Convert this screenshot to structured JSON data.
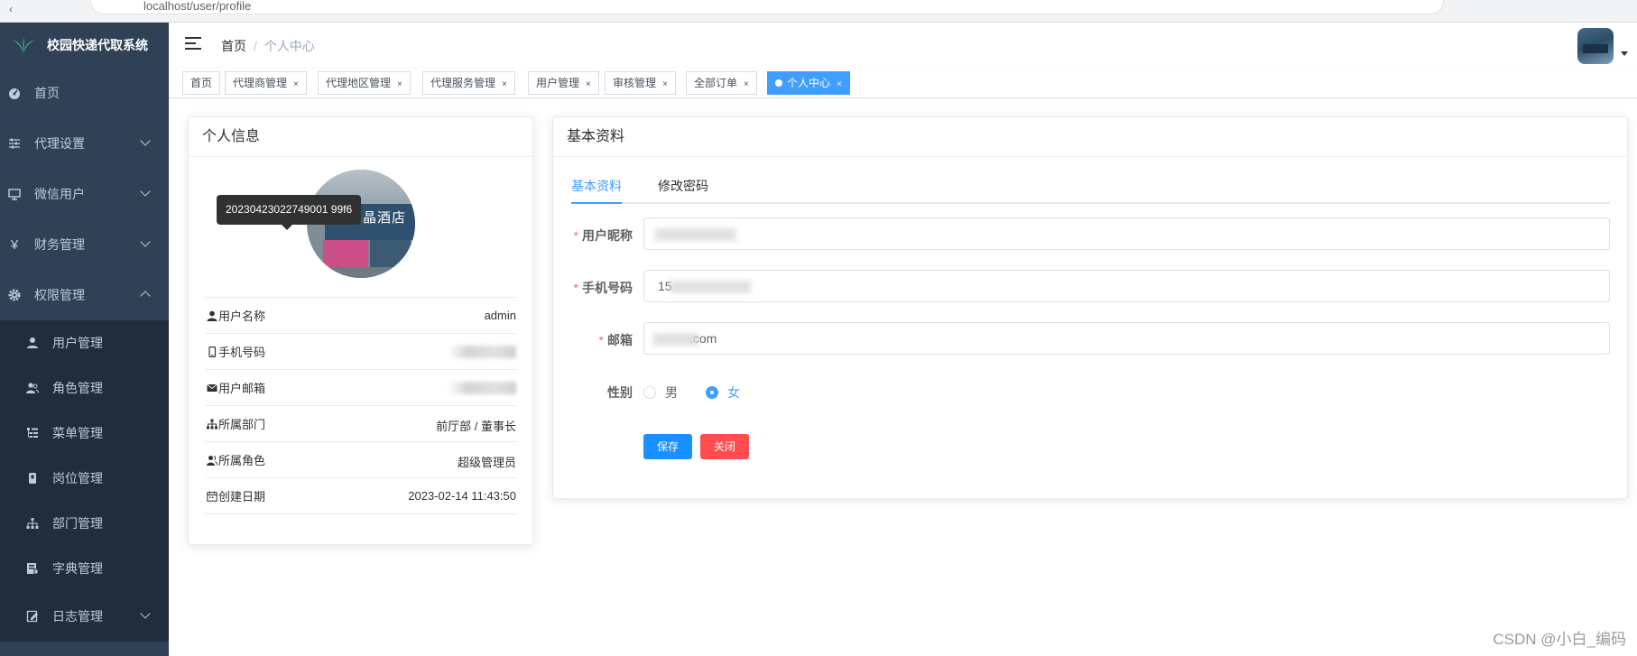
{
  "browser": {
    "url": "localhost/user/profile"
  },
  "app": {
    "title": "校园快递代取系统"
  },
  "sidebar": {
    "items": [
      {
        "label": "首页",
        "icon": "dashboard-icon"
      },
      {
        "label": "代理设置",
        "icon": "sliders-icon"
      },
      {
        "label": "微信用户",
        "icon": "monitor-icon"
      },
      {
        "label": "财务管理",
        "icon": "yen-icon"
      },
      {
        "label": "权限管理",
        "icon": "gear-icon"
      }
    ],
    "submenu": [
      {
        "label": "用户管理",
        "icon": "user-icon"
      },
      {
        "label": "角色管理",
        "icon": "peoples-icon"
      },
      {
        "label": "菜单管理",
        "icon": "tree-table-icon"
      },
      {
        "label": "岗位管理",
        "icon": "post-icon"
      },
      {
        "label": "部门管理",
        "icon": "tree-icon"
      },
      {
        "label": "字典管理",
        "icon": "dict-icon"
      }
    ],
    "log": {
      "label": "日志管理",
      "icon": "log-icon"
    }
  },
  "breadcrumb": {
    "home": "首页",
    "separator": "/",
    "current": "个人中心"
  },
  "tags": [
    {
      "label": "首页"
    },
    {
      "label": "代理商管理"
    },
    {
      "label": "代理地区管理"
    },
    {
      "label": "代理服务管理"
    },
    {
      "label": "用户管理"
    },
    {
      "label": "审核管理"
    },
    {
      "label": "全部订单"
    },
    {
      "label": "个人中心"
    }
  ],
  "tag_close": "×",
  "profile": {
    "header": "个人信息",
    "tooltip": "20230423022749001 99f6",
    "tooltip_text": "20230423022749001 99f6",
    "rows": [
      {
        "label": "用户名称",
        "value": "admin",
        "icon": "user-icon"
      },
      {
        "label": "手机号码",
        "value": "",
        "icon": "phone-icon"
      },
      {
        "label": "用户邮箱",
        "value": "",
        "icon": "email-icon"
      },
      {
        "label": "所属部门",
        "value": "前厅部 / 董事长",
        "icon": "tree-icon"
      },
      {
        "label": "所属角色",
        "value": "超级管理员",
        "icon": "peoples-icon"
      },
      {
        "label": "创建日期",
        "value": "2023-02-14 11:43:50",
        "icon": "date-icon"
      }
    ],
    "avatar_sign": "子水晶酒店"
  },
  "basic": {
    "header": "基本资料",
    "tabs": [
      "基本资料",
      "修改密码"
    ],
    "fields": {
      "nickname_label": "用户昵称",
      "phone_label": "手机号码",
      "phone_value": "15",
      "email_label": "邮箱",
      "email_value": ".com",
      "gender_label": "性别",
      "gender_options": [
        "男",
        "女"
      ],
      "gender_selected": "女"
    },
    "buttons": {
      "save": "保存",
      "close": "关闭"
    }
  },
  "watermark": "CSDN @小白_编码",
  "colors": {
    "sidebar_bg": "#304156",
    "submenu_bg": "#1f2d3d",
    "primary": "#409eff",
    "danger": "#ff4d4f"
  }
}
